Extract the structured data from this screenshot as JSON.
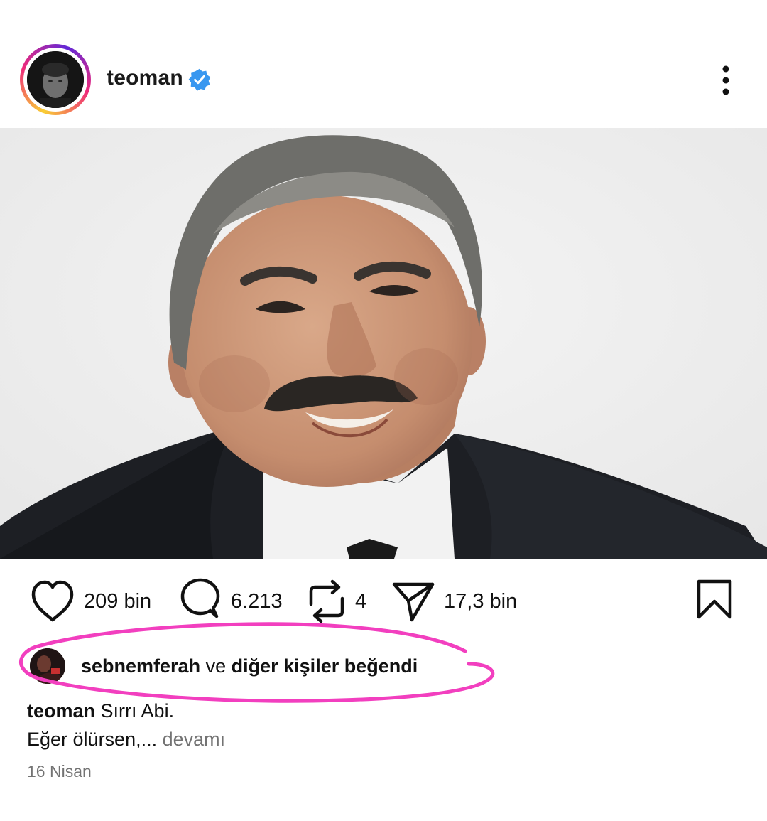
{
  "post": {
    "username": "teoman",
    "verified": true,
    "image_alt": "Portrait of a smiling man with grey hair and a moustache, wearing a dark suit",
    "likes_label": "209 bin",
    "comments_label": "6.213",
    "reposts_label": "4",
    "shares_label": "17,3 bin",
    "liked_by": {
      "user": "sebnemferah",
      "connector": "ve",
      "rest": "diğer kişiler beğendi"
    },
    "caption": {
      "author": "teoman",
      "line1": "Sırrı Abi.",
      "line2": "Eğer ölürsen,...",
      "more": "devamı"
    },
    "date": "16 Nisan"
  },
  "icons": {
    "verified": "verified-badge-icon",
    "more": "more-vertical-icon",
    "like": "heart-icon",
    "comment": "comment-icon",
    "repost": "repost-icon",
    "share": "send-icon",
    "save": "bookmark-icon"
  },
  "colors": {
    "verified_blue": "#3897f0",
    "secondary_text": "#737373",
    "annotation_pink": "#f23fbf"
  }
}
